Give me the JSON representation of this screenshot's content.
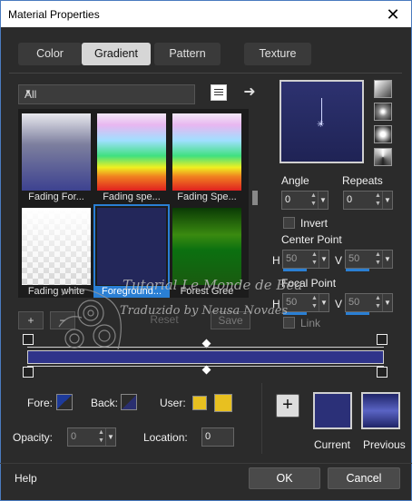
{
  "window": {
    "title": "Material Properties",
    "close": "✕"
  },
  "tabs": [
    "Color",
    "Gradient",
    "Pattern",
    "Texture"
  ],
  "gallery": {
    "category": "All",
    "items": [
      {
        "label": "Fading For..."
      },
      {
        "label": "Fading spe..."
      },
      {
        "label": "Fading Spe..."
      },
      {
        "label": "Fading white"
      },
      {
        "label": "Foreground..."
      },
      {
        "label": "Forest Gree"
      }
    ],
    "add": "+",
    "remove": "−",
    "reset": "Reset",
    "save": "Save"
  },
  "properties": {
    "angle_label": "Angle",
    "angle_value": "0",
    "repeats_label": "Repeats",
    "repeats_value": "0",
    "invert_label": "Invert",
    "center_label": "Center Point",
    "center_h": "50",
    "center_v": "50",
    "focal_label": "Focal Point",
    "focal_h": "50",
    "focal_v": "50",
    "link_label": "Link",
    "h_label": "H",
    "v_label": "V"
  },
  "stops": {
    "fore_label": "Fore:",
    "back_label": "Back:",
    "user_label": "User:",
    "opacity_label": "Opacity:",
    "opacity_value": "0",
    "location_label": "Location:",
    "location_value": "0"
  },
  "preview": {
    "current_label": "Current",
    "previous_label": "Previous",
    "add": "+"
  },
  "footer": {
    "help": "Help",
    "ok": "OK",
    "cancel": "Cancel"
  },
  "watermark": {
    "line1": "Tutorial Le Monde de Bea",
    "line2": "Traduzido by Neusa Novaes"
  },
  "colors": {
    "accent": "#2a7fd4",
    "gradient_fg": "#2f348a",
    "user": "#e8c020"
  }
}
